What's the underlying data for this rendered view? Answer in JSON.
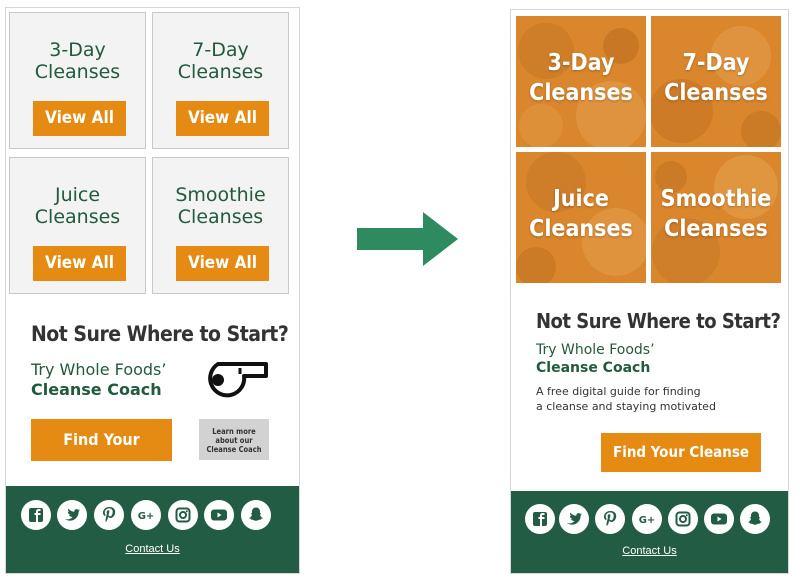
{
  "before": {
    "tiles": [
      {
        "title_line1": "3-Day",
        "title_line2": "Cleanses",
        "button": "View All"
      },
      {
        "title_line1": "7-Day",
        "title_line2": "Cleanses",
        "button": "View All"
      },
      {
        "title_line1": "Juice",
        "title_line2": "Cleanses",
        "button": "View All"
      },
      {
        "title_line1": "Smoothie",
        "title_line2": "Cleanses",
        "button": "View All"
      }
    ],
    "heading": "Not Sure Where to Start?",
    "try_text": "Try Whole Foods’",
    "coach_text": "Cleanse Coach",
    "find_button": "Find Your Cleanse",
    "learn_more": [
      "Learn more",
      "about our",
      "Cleanse Coach"
    ],
    "contact": "Contact Us",
    "social_icons": [
      "facebook-icon",
      "twitter-icon",
      "pinterest-icon",
      "google-plus-icon",
      "instagram-icon",
      "youtube-icon",
      "snapchat-icon"
    ]
  },
  "after": {
    "tiles": [
      {
        "title_line1": "3-Day",
        "title_line2": "Cleanses"
      },
      {
        "title_line1": "7-Day",
        "title_line2": "Cleanses"
      },
      {
        "title_line1": "Juice",
        "title_line2": "Cleanses"
      },
      {
        "title_line1": "Smoothie",
        "title_line2": "Cleanses"
      }
    ],
    "heading": "Not Sure Where to Start?",
    "try_text": "Try Whole Foods’",
    "coach_text": "Cleanse Coach",
    "description_line1": "A free digital guide for finding",
    "description_line2": "a cleanse and staying motivated",
    "find_button": "Find Your Cleanse",
    "contact": "Contact Us",
    "social_icons": [
      "facebook-icon",
      "twitter-icon",
      "pinterest-icon",
      "google-plus-icon",
      "instagram-icon",
      "youtube-icon",
      "snapchat-icon"
    ]
  },
  "colors": {
    "orange": "#e58b13",
    "green": "#235c44",
    "arrow": "#2e8b5f"
  }
}
